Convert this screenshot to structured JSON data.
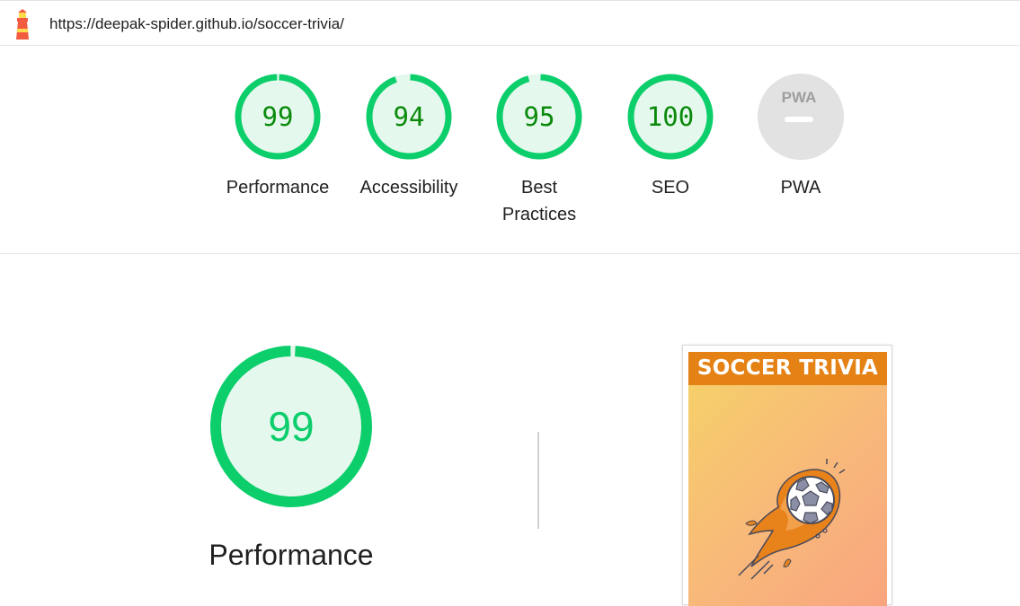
{
  "report": {
    "url": "https://deepak-spider.github.io/soccer-trivia/",
    "logo_icon": "lighthouse-icon"
  },
  "categories": [
    {
      "id": "performance",
      "label": "Performance",
      "score": "99",
      "score_value": 99
    },
    {
      "id": "accessibility",
      "label": "Accessibility",
      "score": "94",
      "score_value": 94
    },
    {
      "id": "best-practices",
      "label": "Best Practices",
      "score": "95",
      "score_value": 95
    },
    {
      "id": "seo",
      "label": "SEO",
      "score": "100",
      "score_value": 100
    },
    {
      "id": "pwa",
      "label": "PWA",
      "badge_text": "PWA",
      "icon": "pwa-badge-icon"
    }
  ],
  "performance_section": {
    "score": "99",
    "score_value": 99,
    "title": "Performance"
  },
  "screenshot": {
    "title": "SOCCER TRIVIA",
    "image_icon": "flaming-soccer-ball-icon"
  },
  "colors": {
    "pass_ring": "#0cce6b",
    "pass_fill": "#e5f8ee",
    "pass_text": "#0a8a0a",
    "big_text": "#0cce6b",
    "pwa_gray": "#e2e2e2",
    "brand_orange": "#e58215"
  }
}
